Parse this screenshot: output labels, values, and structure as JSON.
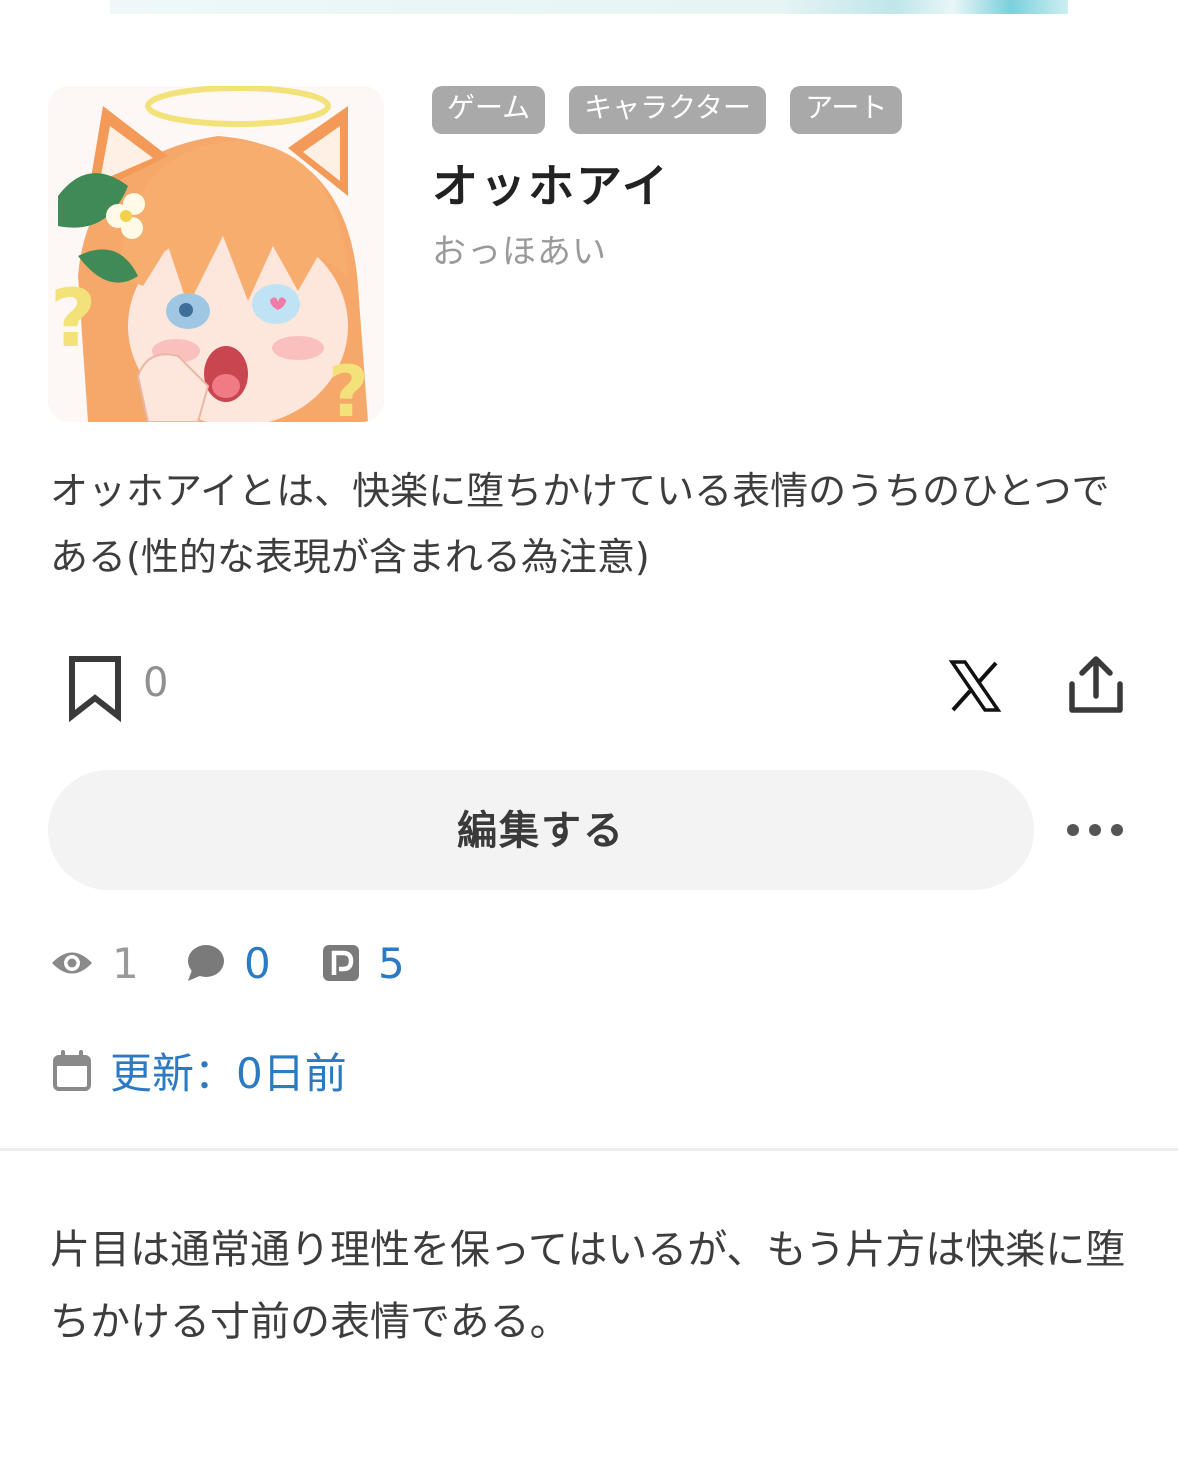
{
  "article": {
    "tags": [
      "ゲーム",
      "キャラクター",
      "アート"
    ],
    "title": "オッホアイ",
    "reading": "おっほあい",
    "summary": "オッホアイとは、快楽に堕ちかけている表情のうちのひとつである(性的な表現が含まれる為注意)",
    "body": "片目は通常通り理性を保ってはいるが、もう片方は快楽に堕ちかける寸前の表情である。"
  },
  "actions": {
    "bookmark_count": "0",
    "edit_label": "編集する"
  },
  "stats": {
    "views": "1",
    "comments": "0",
    "pixiv": "5"
  },
  "updated": {
    "label": "更新：0日前"
  },
  "icons": {
    "bookmark": "bookmark-icon",
    "x": "x-logo-icon",
    "share": "share-icon",
    "more": "more-horizontal-icon",
    "views": "eye-icon",
    "comments": "speech-bubble-icon",
    "pixiv": "pixiv-icon",
    "calendar": "calendar-icon"
  },
  "colors": {
    "tag_bg": "#a9a9a9",
    "link_blue": "#2b7ac2",
    "muted": "#9a9a9a",
    "button_bg": "#f3f3f3"
  }
}
